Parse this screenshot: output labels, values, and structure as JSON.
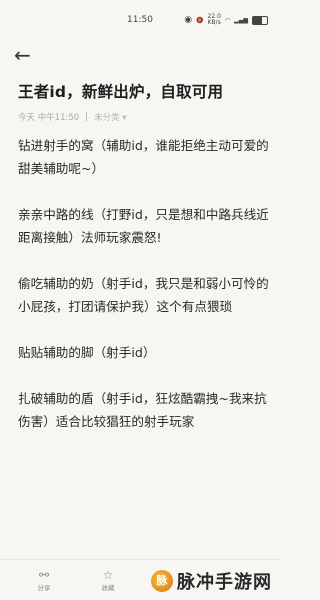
{
  "status_bar": {
    "time": "11:50",
    "net_speed_value": "22.0",
    "net_speed_unit": "KB/s",
    "battery": "65"
  },
  "note": {
    "title": "王者id，新鲜出炉，自取可用",
    "date": "今天 中午11:50",
    "category": "未分类",
    "paragraphs": [
      "钻进射手的窝（辅助id，谁能拒绝主动可爱的甜美辅助呢~）",
      "亲亲中路的线（打野id，只是想和中路兵线近距离接触）法师玩家震怒!",
      "偷吃辅助的奶（射手id，我只是和弱小可怜的小屁孩，打团请保护我）这个有点猥琐",
      "贴贴辅助的脚（射手id）",
      "扎破辅助的盾（射手id，狂炫酷霸拽~我来抗伤害）适合比较猖狂的射手玩家"
    ]
  },
  "bottom_bar": {
    "share_label": "分享",
    "favorite_label": "收藏"
  },
  "watermark": {
    "logo_char": "脉",
    "text": "脉冲手游网"
  }
}
